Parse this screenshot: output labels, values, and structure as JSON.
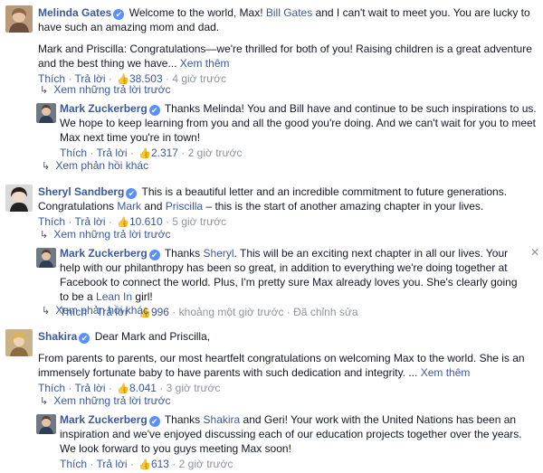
{
  "comments": [
    {
      "author": "Melinda Gates",
      "parts": [
        "Welcome to the world, Max! ",
        "Bill Gates",
        " and I can't wait to meet you. You are lucky to have such an amazing mom and dad."
      ],
      "para2": "Mark and Priscilla: Congratulations—we're thrilled for both of you! Raising children is a great adventure and the best thing we have...",
      "see_more": "Xem thêm",
      "like": "Thích",
      "reply": "Trả lời",
      "likes": "38.503",
      "time": "4 giờ trước",
      "view_replies": "Xem những trả lời trước",
      "reply_item": {
        "author": "Mark Zuckerberg",
        "text": "Thanks Melinda! You and Bill have and continue to be such inspirations to us. We hope to keep learning from you and all the good you're doing. And we can't wait for you to meet Max next time you're in town!",
        "like": "Thích",
        "reply": "Trả lời",
        "likes": "2.317",
        "time": "2 giờ trước"
      },
      "more_replies": "Xem phản hồi khác"
    },
    {
      "author": "Sheryl Sandberg",
      "parts": [
        "This is a beautiful letter and an incredible commitment to future generations. Congratulations ",
        "Mark",
        " and ",
        "Priscilla",
        " – this is the start of another amazing chapter in your lives."
      ],
      "like": "Thích",
      "reply": "Trả lời",
      "likes": "10.610",
      "time": "5 giờ trước",
      "view_replies": "Xem những trả lời trước",
      "reply_item": {
        "author": "Mark Zuckerberg",
        "parts": [
          "Thanks ",
          "Sheryl",
          ". This will be an exciting next chapter in all our lives. Your help with our philanthropy has been so great, in addition to everything we're doing together at Facebook to connect the world. Plus, I'm pretty sure Max already loves you. She's clearly going to be a ",
          "Lean In",
          " girl!"
        ],
        "like": "Thích",
        "reply": "Trả lời",
        "likes": "996",
        "time": "khoảng một giờ trước",
        "edited": "Đã chỉnh sửa",
        "close": "✕"
      },
      "more_replies": "Xem phản hồi khác"
    },
    {
      "author": "Shakira",
      "text": "Dear Mark and Priscilla,",
      "para2": "From parents to parents, our most heartfelt congratulations on welcoming Max to the world. She is an immensely fortunate baby to have parents with such dedication and integrity. ...",
      "see_more": "Xem thêm",
      "like": "Thích",
      "reply": "Trả lời",
      "likes": "8.041",
      "time": "3 giờ trước",
      "view_replies": "Xem những trả lời trước",
      "reply_item": {
        "author": "Mark Zuckerberg",
        "parts": [
          "Thanks ",
          "Shakira",
          " and Geri! Your work with the United Nations has been an inspiration and we've enjoyed discussing each of our education projects together over the years. We look forward to you guys meeting Max soon!"
        ],
        "like": "Thích",
        "reply": "Trả lời",
        "likes": "613",
        "time": "2 giờ trước"
      }
    }
  ],
  "icons": {
    "verified": "verified-badge-icon",
    "like": "thumbs-up-icon",
    "reply_arrow": "reply-arrow-icon",
    "close": "close-icon"
  },
  "colors": {
    "link": "#3b5998",
    "meta": "#90949c",
    "verified": "#5890ff"
  }
}
